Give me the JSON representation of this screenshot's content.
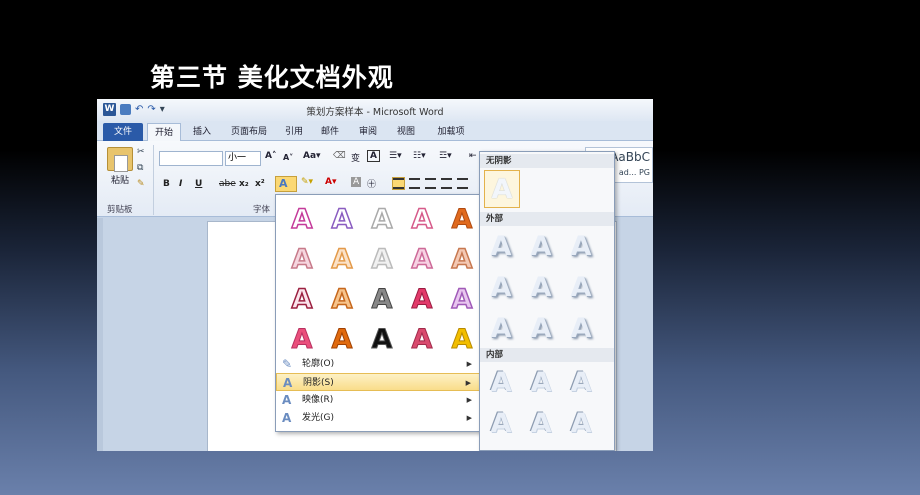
{
  "slide_title": "第三节  美化文档外观",
  "window": {
    "title": "策划方案样本 - Microsoft Word",
    "app_icon": "W"
  },
  "tabs": [
    "文件",
    "开始",
    "插入",
    "页面布局",
    "引用",
    "邮件",
    "审阅",
    "视图",
    "加载项"
  ],
  "ribbon": {
    "paste_label": "粘贴",
    "clipboard_label": "剪贴板",
    "font_label": "字体",
    "font_size": "小一",
    "bold": "B",
    "italic": "I",
    "underline": "U",
    "strike": "abe",
    "sub": "x₂",
    "sup": "x²",
    "style_preview": "AaBbC",
    "style_name": "ad... PG"
  },
  "text_effects_menu": {
    "rows": [
      [
        "A",
        "A",
        "A",
        "A",
        "A"
      ],
      [
        "A",
        "A",
        "A",
        "A",
        "A"
      ],
      [
        "A",
        "A",
        "A",
        "A",
        "A"
      ],
      [
        "A",
        "A",
        "A",
        "A",
        "A"
      ]
    ],
    "items": [
      {
        "label": "轮廓(O)",
        "icon": "outline-icon"
      },
      {
        "label": "阴影(S)",
        "icon": "shadow-icon",
        "selected": true
      },
      {
        "label": "映像(R)",
        "icon": "reflection-icon"
      },
      {
        "label": "发光(G)",
        "icon": "glow-icon"
      }
    ]
  },
  "shadow_submenu": {
    "no_shadow": "无阴影",
    "outer": "外部",
    "inner": "内部"
  }
}
